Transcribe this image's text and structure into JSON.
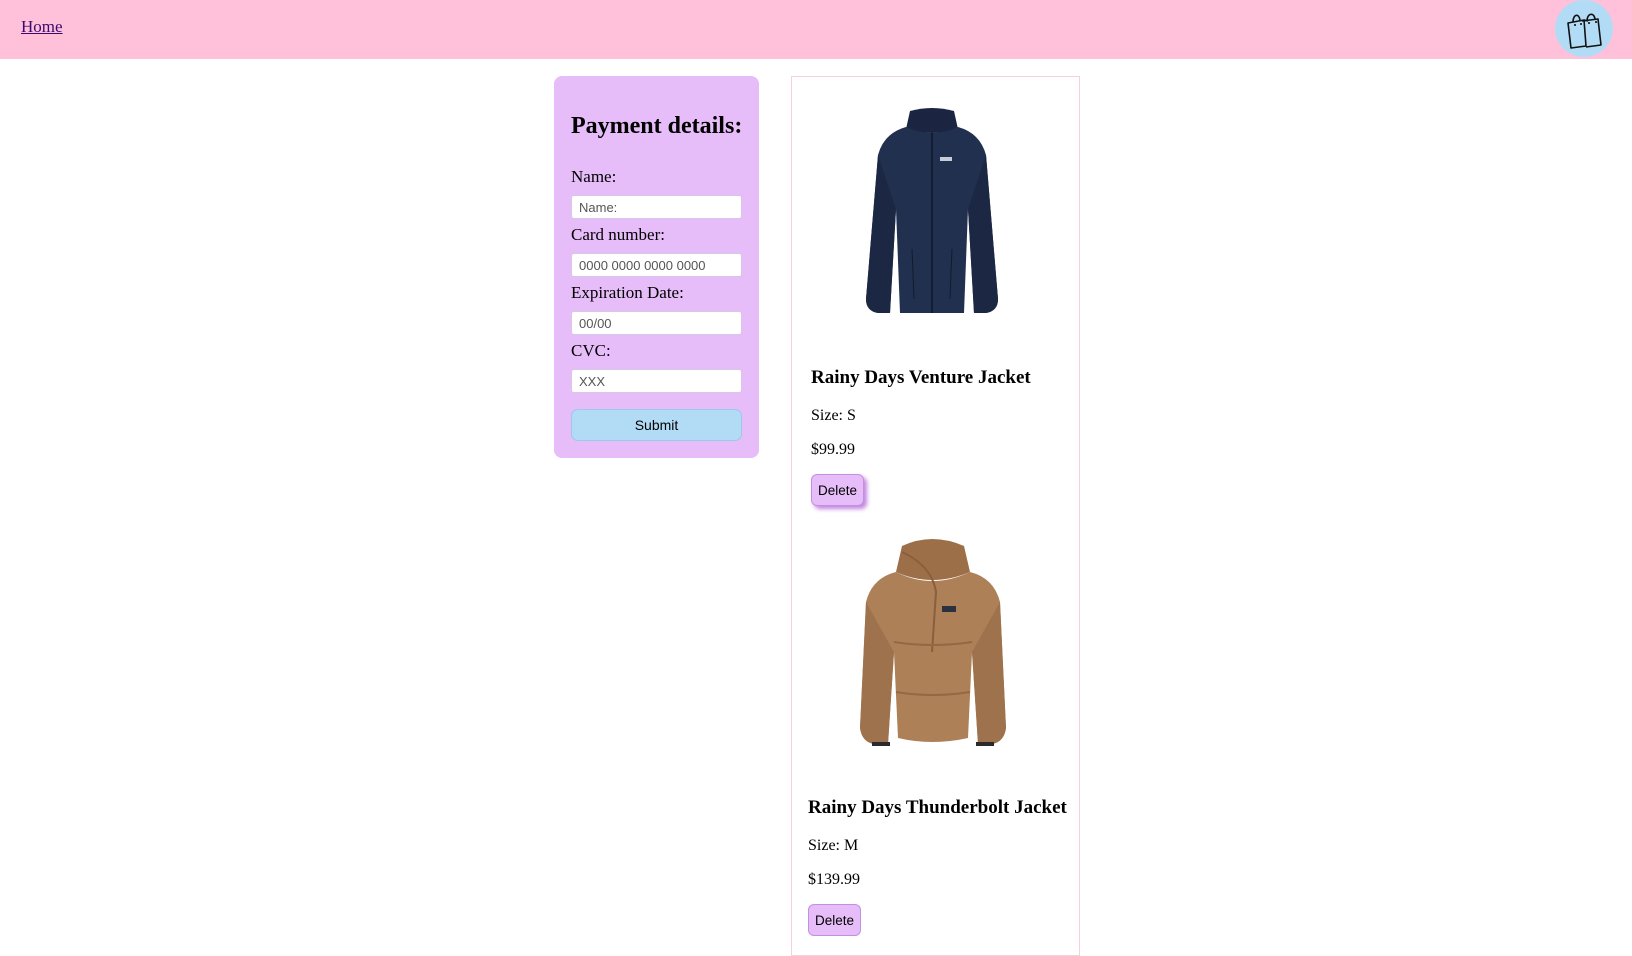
{
  "nav": {
    "home_label": "Home",
    "cart_icon": "shopping-bags-icon"
  },
  "payment": {
    "title": "Payment details:",
    "name_label": "Name:",
    "name_placeholder": "Name:",
    "card_label": "Card number:",
    "card_placeholder": "0000 0000 0000 0000",
    "expiry_label": "Expiration Date:",
    "expiry_placeholder": "00/00",
    "cvc_label": "CVC:",
    "cvc_placeholder": "XXX",
    "submit_label": "Submit"
  },
  "cart": {
    "items": [
      {
        "name": "Rainy Days Venture Jacket",
        "size": "Size: S",
        "price": "$99.99",
        "delete_label": "Delete",
        "image": "navy-fleece-jacket-image",
        "color": "#1f2a44"
      },
      {
        "name": "Rainy Days Thunderbolt Jacket",
        "size": "Size: M",
        "price": "$139.99",
        "delete_label": "Delete",
        "image": "brown-sherpa-jacket-image",
        "color": "#a87a52"
      }
    ]
  },
  "colors": {
    "header_bg": "#ffc0da",
    "panel_bg": "#e6bdf8",
    "button_blue": "#b2dcf6"
  }
}
